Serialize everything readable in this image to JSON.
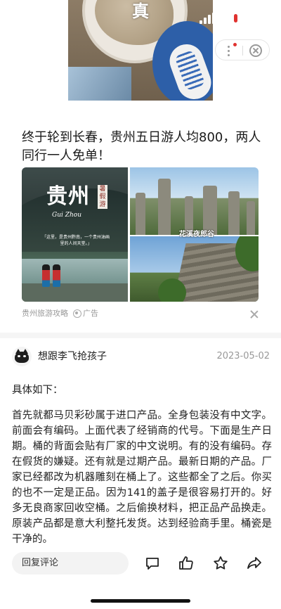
{
  "hero": {
    "overlay_char": "真"
  },
  "ad": {
    "title": "终于轮到长春，贵州五日游人均800，两人同行一人免单！",
    "poster": {
      "big_text": "贵州",
      "side_text": "暑假游",
      "pinyin": "Gui Zhou",
      "caption": "「这里，是贵州黔南，一个贵州油画里的人间天堂。」",
      "place_label": "花溪夜郎谷"
    },
    "source": "贵州旅游攻略",
    "tag": "广告"
  },
  "answer": {
    "username": "想跟李飞抢孩子",
    "date": "2023-05-02",
    "intro": "具体如下：",
    "body": "首先就都马贝彩砂属于进口产品。全身包装没有中文字。前面会有编码。上面代表了经销商的代号。下面是生产日期。桶的背面会贴有厂家的中文说明。有的没有编码。存在假货的嫌疑。还有就是过期产品。最新日期的产品。厂家已经都改为机器雕刻在桶上了。这些都全了之后。你买的也不一定是正品。因为141的盖子是很容易打开的。好多无良商家回收空桶。之后偷换材料，把正品产品换走。原装产品都是意大利整托发货。达到经验商手里。桶瓷是干净的。"
  },
  "bottom_bar": {
    "comment_placeholder": "回复评论"
  }
}
